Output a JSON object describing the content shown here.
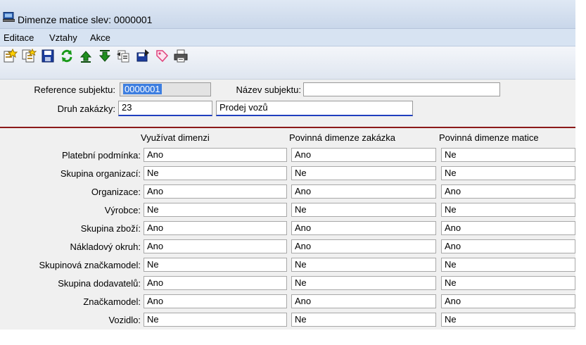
{
  "window": {
    "title": "Dimenze matice slev: 0000001"
  },
  "menu": [
    {
      "label": "Editace"
    },
    {
      "label": "Vztahy"
    },
    {
      "label": "Akce"
    }
  ],
  "toolbar": [
    {
      "icon": "new-record-icon"
    },
    {
      "icon": "copy-record-icon"
    },
    {
      "icon": "save-icon"
    },
    {
      "icon": "refresh-icon"
    },
    {
      "icon": "move-up-icon"
    },
    {
      "icon": "move-down-icon"
    },
    {
      "icon": "insert-icon"
    },
    {
      "icon": "export-icon"
    },
    {
      "icon": "tags-icon"
    },
    {
      "icon": "print-icon"
    }
  ],
  "form": {
    "reference_label": "Reference subjektu:",
    "reference_value": "0000001",
    "name_label": "Název subjektu:",
    "name_value": "",
    "order_type_label": "Druh zakázky:",
    "order_type_code": "23",
    "order_type_name": "Prodej vozů"
  },
  "grid": {
    "columns": [
      "Využívat dimenzi",
      "Povinná dimenze zakázka",
      "Povinná dimenze matice"
    ],
    "rows": [
      {
        "label": "Platební podmínka:",
        "values": [
          "Ano",
          "Ano",
          "Ne"
        ]
      },
      {
        "label": "Skupina organizací:",
        "values": [
          "Ne",
          "Ne",
          "Ne"
        ]
      },
      {
        "label": "Organizace:",
        "values": [
          "Ano",
          "Ano",
          "Ano"
        ]
      },
      {
        "label": "Výrobce:",
        "values": [
          "Ne",
          "Ne",
          "Ne"
        ]
      },
      {
        "label": "Skupina zboží:",
        "values": [
          "Ano",
          "Ano",
          "Ano"
        ]
      },
      {
        "label": "Nákladový okruh:",
        "values": [
          "Ano",
          "Ano",
          "Ano"
        ]
      },
      {
        "label": "Skupinová značkamodel:",
        "values": [
          "Ne",
          "Ne",
          "Ne"
        ]
      },
      {
        "label": "Skupina dodavatelů:",
        "values": [
          "Ano",
          "Ne",
          "Ne"
        ]
      },
      {
        "label": "Značkamodel:",
        "values": [
          "Ano",
          "Ano",
          "Ano"
        ]
      },
      {
        "label": "Vozidlo:",
        "values": [
          "Ne",
          "Ne",
          "Ne"
        ]
      }
    ]
  },
  "colors": {
    "separator": "#8b1a1a",
    "field_underline": "#1f3fbf",
    "selection": "#3d7ee0"
  }
}
